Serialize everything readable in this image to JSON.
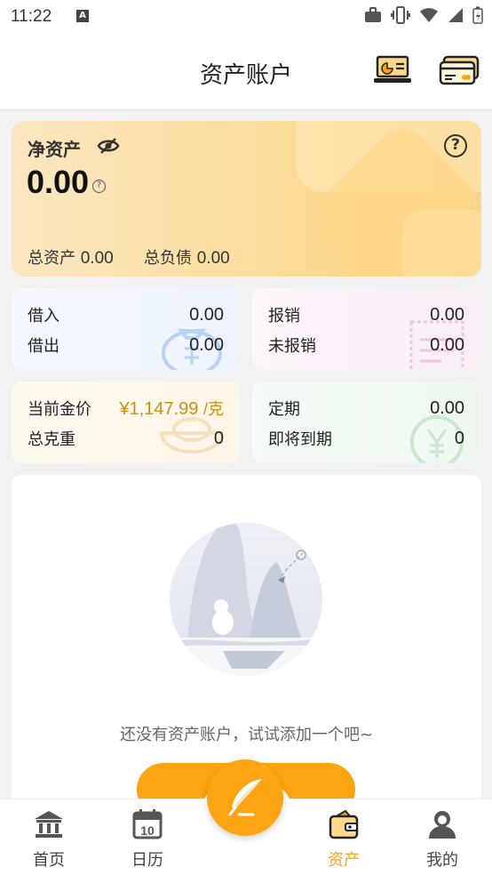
{
  "status_bar": {
    "time": "11:22",
    "a_badge": "A"
  },
  "header": {
    "title": "资产账户"
  },
  "net_worth": {
    "label": "净资产",
    "value": "0.00",
    "help": "?",
    "total_assets_label": "总资产",
    "total_assets_value": "0.00",
    "total_liabilities_label": "总负债",
    "total_liabilities_value": "0.00"
  },
  "cards": {
    "loans": {
      "borrow_in_label": "借入",
      "borrow_in_value": "0.00",
      "lend_out_label": "借出",
      "lend_out_value": "0.00"
    },
    "reimburse": {
      "reimbursed_label": "报销",
      "reimbursed_value": "0.00",
      "pending_label": "未报销",
      "pending_value": "0.00"
    },
    "gold": {
      "price_label": "当前金价",
      "price_value": "¥1,147.99",
      "price_unit": "/克",
      "weight_label": "总克重",
      "weight_value": "0"
    },
    "fixed": {
      "fixed_label": "定期",
      "fixed_value": "0.00",
      "due_label": "即将到期",
      "due_value": "0"
    }
  },
  "empty_state": {
    "message": "还没有资产账户，试试添加一个吧~"
  },
  "tabs": [
    {
      "label": "首页",
      "icon": "bank-icon"
    },
    {
      "label": "日历",
      "icon": "calendar-icon",
      "day": "10"
    },
    {
      "label": "",
      "icon": "quill-icon"
    },
    {
      "label": "资产",
      "icon": "wallet-icon"
    },
    {
      "label": "我的",
      "icon": "person-icon"
    }
  ],
  "colors": {
    "accent": "#fca411",
    "gold_text": "#c8920c"
  }
}
